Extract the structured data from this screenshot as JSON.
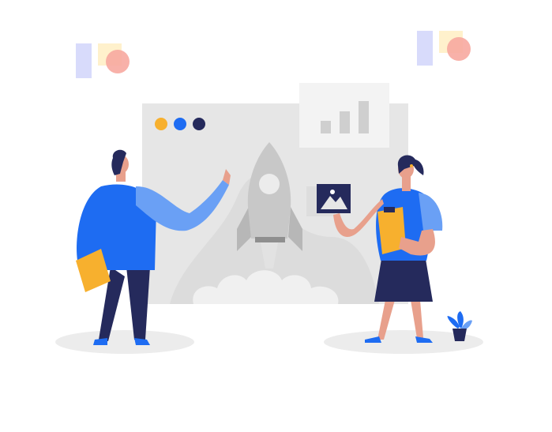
{
  "illustration": {
    "subject": "rocket-launch",
    "colors": {
      "background": "#ffffff",
      "board": "#e6e6e6",
      "board_inner": "#d9d9d9",
      "rocket": "#c8c8c8",
      "rocket_dark": "#8f8f8f",
      "blue": "#1e6cf2",
      "blue_light": "#6aa0f5",
      "navy": "#252a5c",
      "orange": "#f7b02e",
      "skin": "#e8a08c",
      "pink": "#f7a9a0",
      "lavender": "#d8dbfb",
      "cream": "#fff1cc",
      "shadow": "#ececec"
    },
    "window_dots": [
      "#f7b02e",
      "#1e6cf2",
      "#252a5c"
    ],
    "chart_bars": [
      0.35,
      0.6,
      0.9
    ]
  }
}
